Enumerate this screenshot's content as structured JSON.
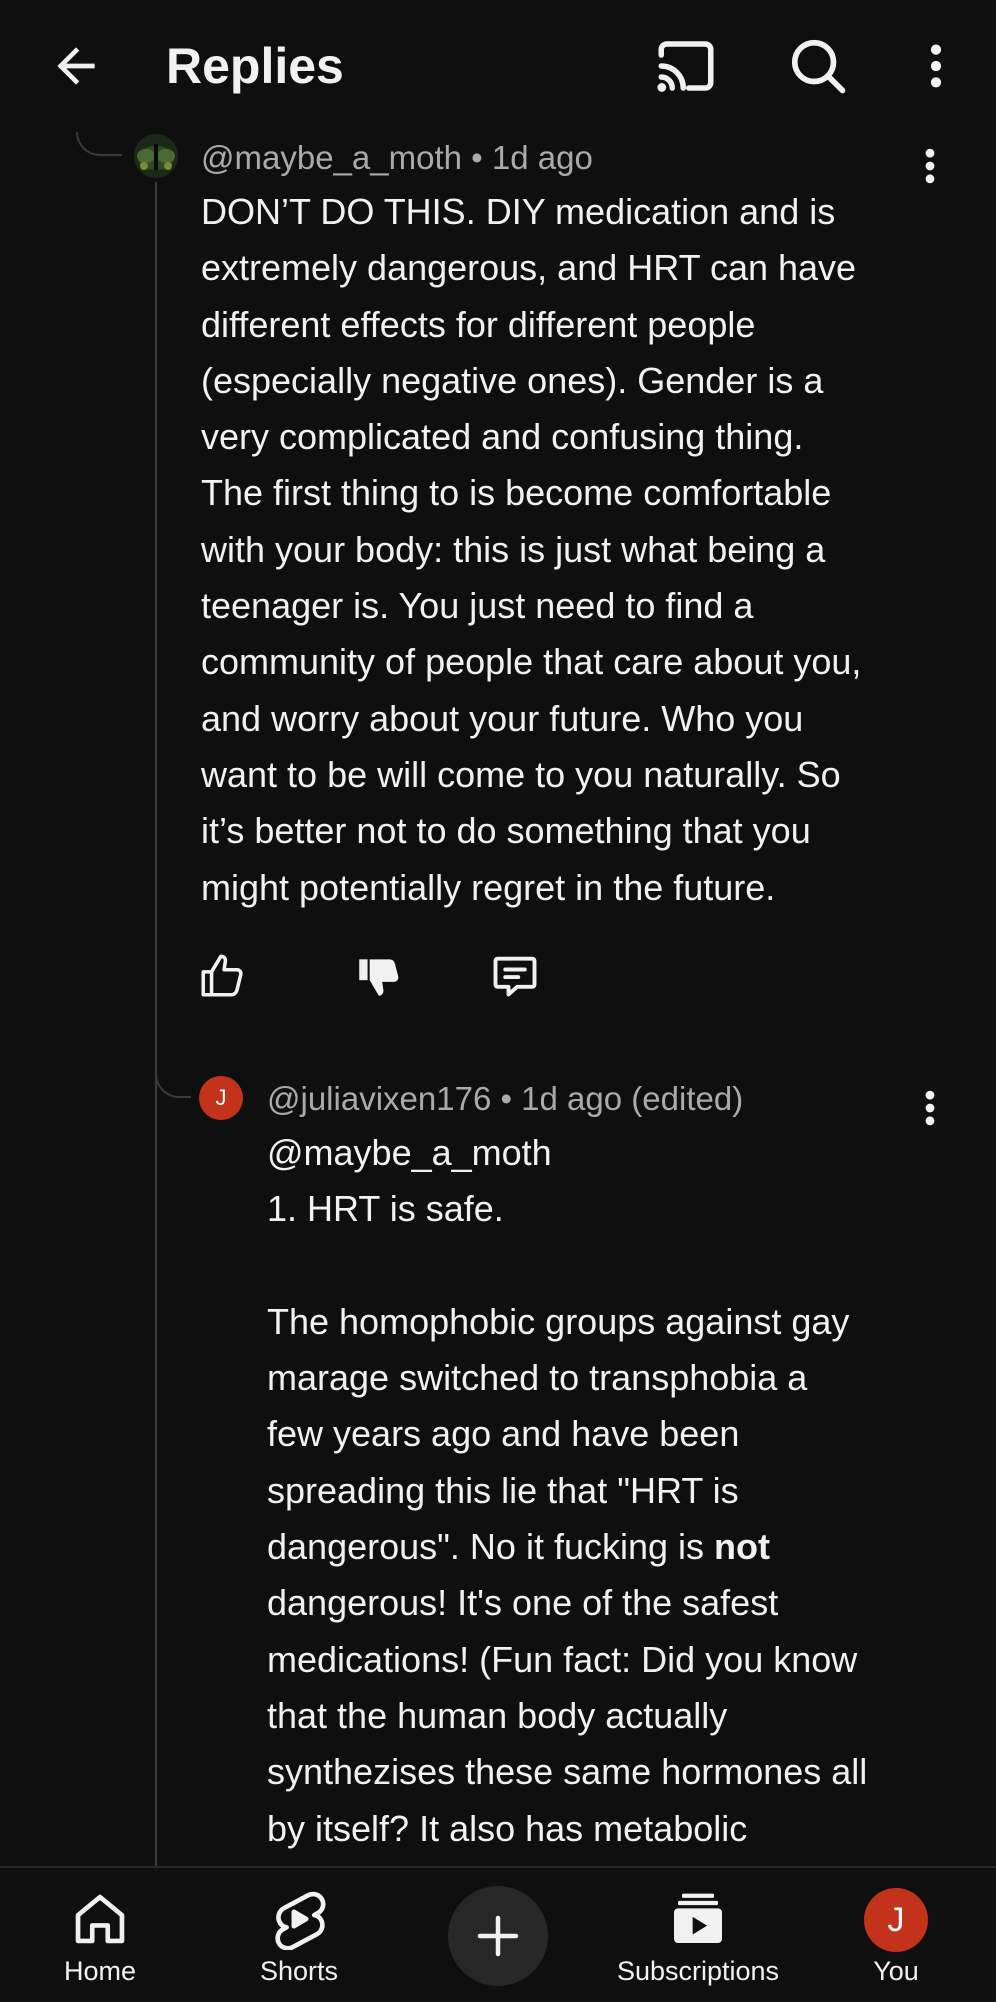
{
  "colors": {
    "background": "#0f0f0f",
    "text_primary": "#f1f1f1",
    "text_secondary": "#aaaaaa",
    "thread_line": "#3a3a3a",
    "user_avatar": "#c3331b"
  },
  "header": {
    "title": "Replies",
    "icons": [
      "back-arrow-icon",
      "cast-icon",
      "search-icon",
      "more-vert-icon"
    ]
  },
  "comments": [
    {
      "author": "@maybe_a_moth",
      "meta": "@maybe_a_moth • 1d ago",
      "avatar_icon": "moth-avatar",
      "body": "DON’T DO THIS. DIY medication and is\nextremely dangerous, and HRT can have\ndifferent effects for different people\n(especially negative ones). Gender is a\nvery complicated and confusing thing.\nThe first thing to is become comfortable\nwith your body: this is just what being a\nteenager is. You just need to find a\ncommunity of people that care about you,\nand worry about your future. Who you\nwant to be will come to you naturally. So\nit’s better not to do something that you\nmight potentially regret in the future."
    },
    {
      "author": "@juliavixen176",
      "meta": "@juliavixen176 • 1d ago (edited)",
      "avatar_initial": "J",
      "body_before_bold": "@maybe_a_moth\n1. HRT is safe.\n\nThe homophobic groups against gay\nmarage switched to transphobia a\nfew years ago and have been\nspreading this lie that \"HRT is\ndangerous\". No it fucking is ",
      "body_bold": "not",
      "body_after_bold": "\ndangerous! It's one of the safest\nmedications! (Fun fact: Did you know\nthat the human body actually\nsynthezises these same hormones all\nby itself? It also has metabolic"
    }
  ],
  "actions": [
    "like-icon",
    "dislike-icon",
    "reply-icon"
  ],
  "bottom_nav": {
    "items": [
      {
        "label": "Home",
        "icon": "home-icon"
      },
      {
        "label": "Shorts",
        "icon": "shorts-icon"
      },
      {
        "label": "",
        "icon": "create-plus-icon"
      },
      {
        "label": "Subscriptions",
        "icon": "subscriptions-icon"
      },
      {
        "label": "You",
        "avatar_initial": "J"
      }
    ]
  }
}
